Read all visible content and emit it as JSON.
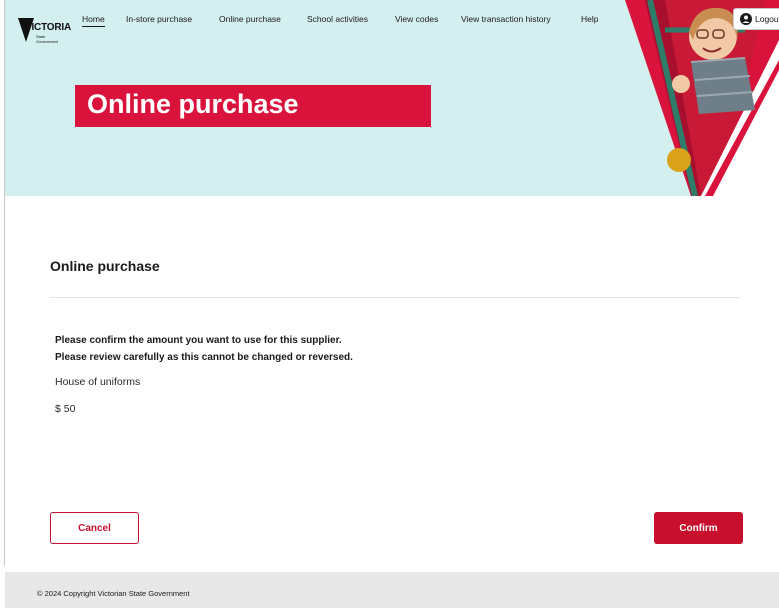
{
  "brand": {
    "logo_word": "VICTORIA",
    "logo_sub": "State Government"
  },
  "nav": {
    "items": [
      {
        "label": "Home",
        "active": true
      },
      {
        "label": "In-store purchase"
      },
      {
        "label": "Online purchase"
      },
      {
        "label": "School activities"
      },
      {
        "label": "View codes"
      },
      {
        "label": "View transaction history"
      },
      {
        "label": "Help"
      }
    ],
    "logout_label": "Logout"
  },
  "hero": {
    "banner_title": "Online purchase"
  },
  "main": {
    "section_title": "Online purchase",
    "confirm_message_line1": "Please confirm the amount you want to use for this supplier.",
    "confirm_message_line2": "Please review carefully as this cannot be changed or reversed.",
    "supplier_name": "House of uniforms",
    "amount": "$ 50"
  },
  "actions": {
    "cancel_label": "Cancel",
    "confirm_label": "Confirm"
  },
  "footer": {
    "copyright": "© 2024 Copyright Victorian State Government"
  },
  "colors": {
    "brand_red": "#d9133c",
    "button_red": "#c8102e",
    "hero_bg": "#d4eff0",
    "footer_bg": "#e8e8e8"
  }
}
